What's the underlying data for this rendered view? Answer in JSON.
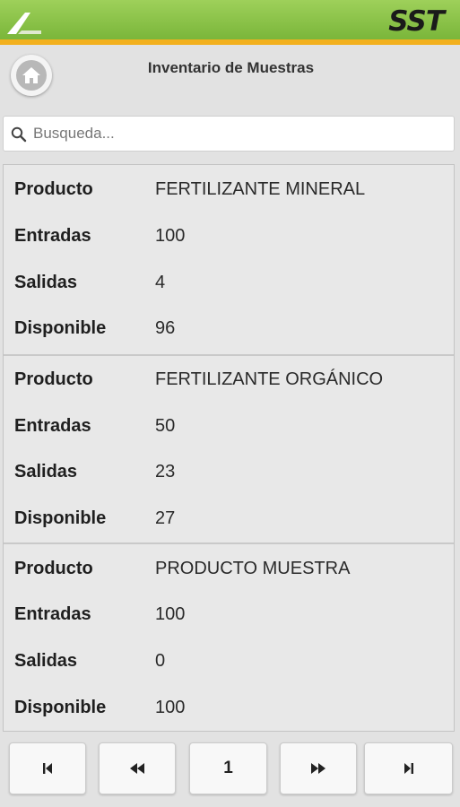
{
  "app": {
    "brand": "SST"
  },
  "header": {
    "title": "Inventario de Muestras",
    "home_icon": "home-icon"
  },
  "search": {
    "placeholder": "Busqueda...",
    "value": ""
  },
  "labels": {
    "producto": "Producto",
    "entradas": "Entradas",
    "salidas": "Salidas",
    "disponible": "Disponible"
  },
  "items": [
    {
      "producto": "FERTILIZANTE MINERAL",
      "entradas": "100",
      "salidas": "4",
      "disponible": "96"
    },
    {
      "producto": "FERTILIZANTE ORGÁNICO",
      "entradas": "50",
      "salidas": "23",
      "disponible": "27"
    },
    {
      "producto": "PRODUCTO MUESTRA",
      "entradas": "100",
      "salidas": "0",
      "disponible": "100"
    }
  ],
  "pagination": {
    "current_page": "1",
    "first_icon": "first-page-icon",
    "prev_icon": "previous-page-icon",
    "next_icon": "next-page-icon",
    "last_icon": "last-page-icon"
  },
  "colors": {
    "topbar": "#7ab63a",
    "topbar_accent": "#f2b01e",
    "background": "#e2e2e2"
  }
}
